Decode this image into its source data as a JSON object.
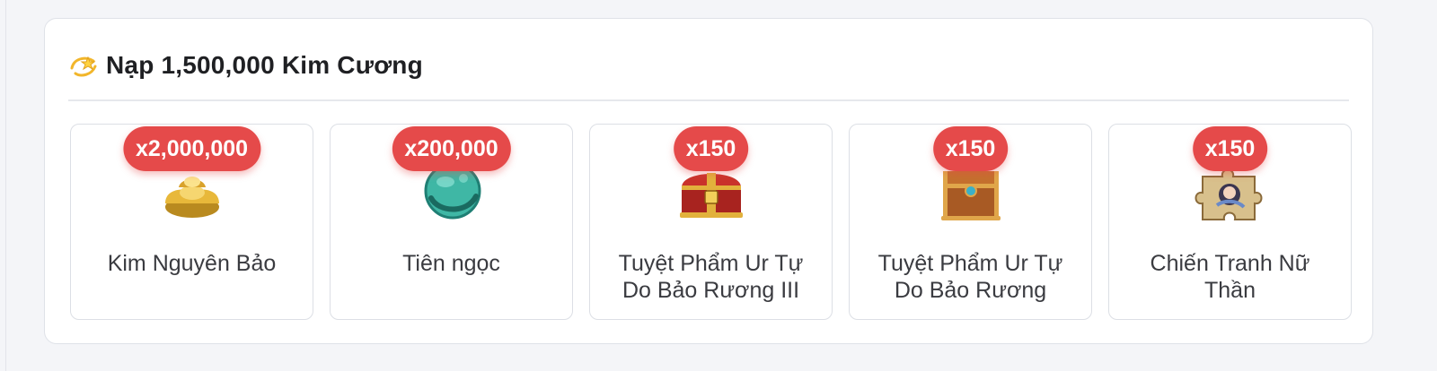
{
  "header": {
    "title": "Nạp 1,500,000 Kim Cương",
    "icon": "dizzy-star-icon"
  },
  "items": [
    {
      "quantity": "x2,000,000",
      "label": "Kim Nguyên Bảo",
      "icon": "gold-ingot-icon"
    },
    {
      "quantity": "x200,000",
      "label": "Tiên ngọc",
      "icon": "jade-icon"
    },
    {
      "quantity": "x150",
      "label": "Tuyệt Phẩm Ur Tự Do Bảo Rương III",
      "icon": "red-treasure-chest-icon"
    },
    {
      "quantity": "x150",
      "label": "Tuyệt Phẩm Ur Tự Do Bảo Rương",
      "icon": "bronze-treasure-chest-icon"
    },
    {
      "quantity": "x150",
      "label": "Chiến Tranh Nữ Thần",
      "icon": "puzzle-piece-icon"
    }
  ],
  "colors": {
    "badge": "#e54a4a",
    "title": "#1f2023",
    "label": "#3a3b40"
  }
}
